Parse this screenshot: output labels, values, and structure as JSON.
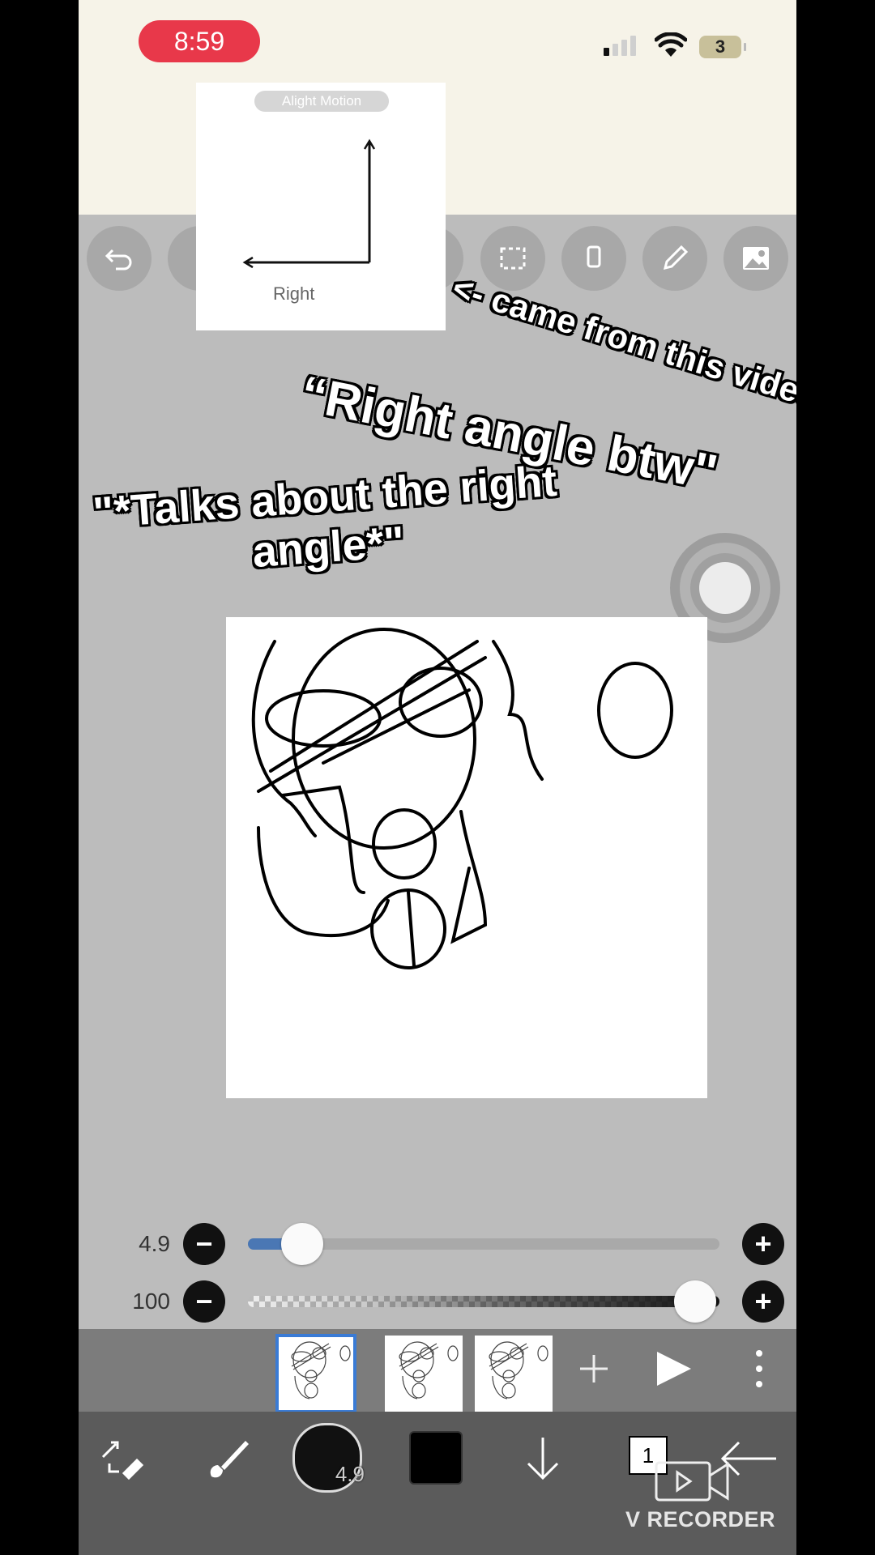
{
  "status": {
    "time": "8:59",
    "battery": "3"
  },
  "inset": {
    "watermark": "Alight Motion",
    "label": "Right"
  },
  "captions": {
    "came_from": "<- came from this video",
    "right_angle": "“Right angle btw\"",
    "talks": "\"*Talks about the right angle*\""
  },
  "sliders": {
    "size": {
      "value": "4.9",
      "fraction": 0.07
    },
    "opacity": {
      "value": "100",
      "fraction": 1.0
    }
  },
  "brush": {
    "size_label": "4.9"
  },
  "layer": {
    "count": "1"
  },
  "watermark": "V RECORDER",
  "icons": {
    "toolbar": [
      "undo-icon",
      "menu-icon",
      "layers-icon",
      "select-icon",
      "vibrate-icon",
      "pen-icon",
      "image-icon"
    ],
    "bottom": [
      "transform-icon",
      "brush-icon",
      "brush-size-icon",
      "color-icon",
      "down-arrow-icon",
      "layer-icon",
      "back-icon"
    ]
  },
  "colors": {
    "accent": "#3a7bd5",
    "status_pill": "#e8384a"
  }
}
